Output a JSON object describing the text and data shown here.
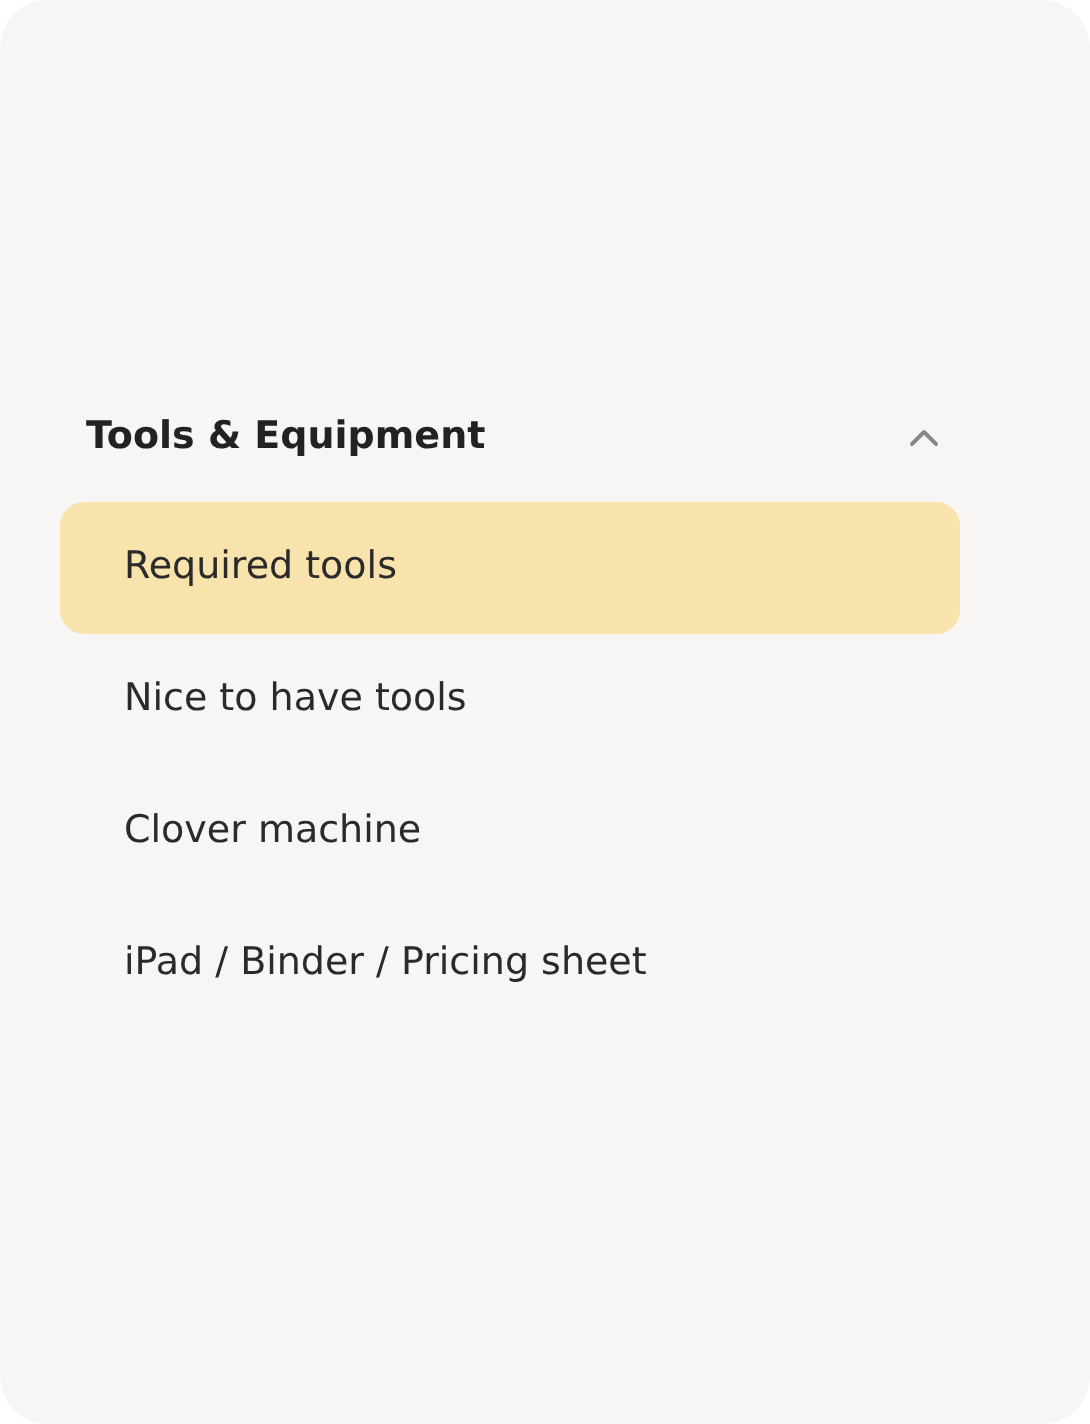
{
  "section": {
    "title": "Tools & Equipment",
    "expanded": true,
    "items": [
      {
        "label": "Required tools",
        "selected": true
      },
      {
        "label": "Nice to have tools",
        "selected": false
      },
      {
        "label": "Clover machine",
        "selected": false
      },
      {
        "label": "iPad / Binder / Pricing sheet",
        "selected": false
      }
    ]
  }
}
